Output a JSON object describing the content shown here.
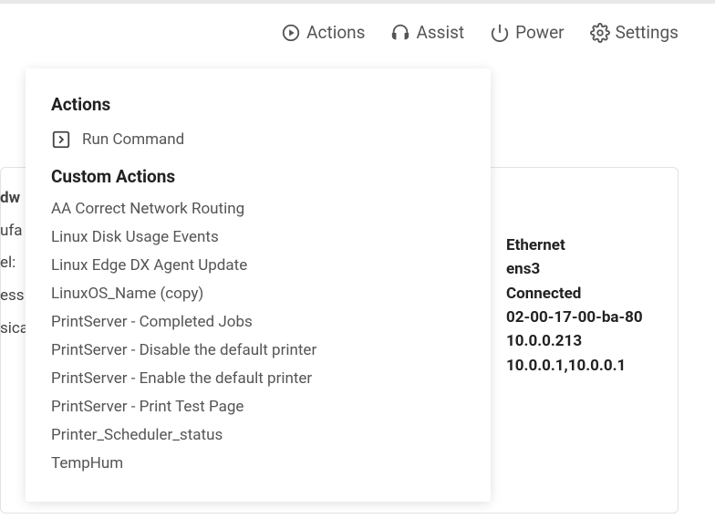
{
  "toolbar": {
    "actions": "Actions",
    "assist": "Assist",
    "power": "Power",
    "settings": "Settings"
  },
  "dropdown": {
    "heading_actions": "Actions",
    "run_command_label": "Run Command",
    "heading_custom": "Custom Actions",
    "custom_items": {
      "0": "AA Correct Network Routing",
      "1": "Linux Disk Usage Events",
      "2": "Linux Edge DX Agent Update",
      "3": "LinuxOS_Name (copy)",
      "4": "PrintServer - Completed Jobs",
      "5": "PrintServer - Disable the default printer",
      "6": "PrintServer - Enable the default printer",
      "7": "PrintServer - Print Test Page",
      "8": "Printer_Scheduler_status",
      "9": "TempHum"
    }
  },
  "left_fragment": {
    "l0": "dw",
    "l1": "ufa",
    "l2": "el:",
    "l3": "ess",
    "l4": "sica"
  },
  "network": {
    "type": "Ethernet",
    "iface": "ens3",
    "status": "Connected",
    "mac": "02-00-17-00-ba-80",
    "ip": "10.0.0.213",
    "dns": "10.0.0.1,10.0.0.1"
  }
}
